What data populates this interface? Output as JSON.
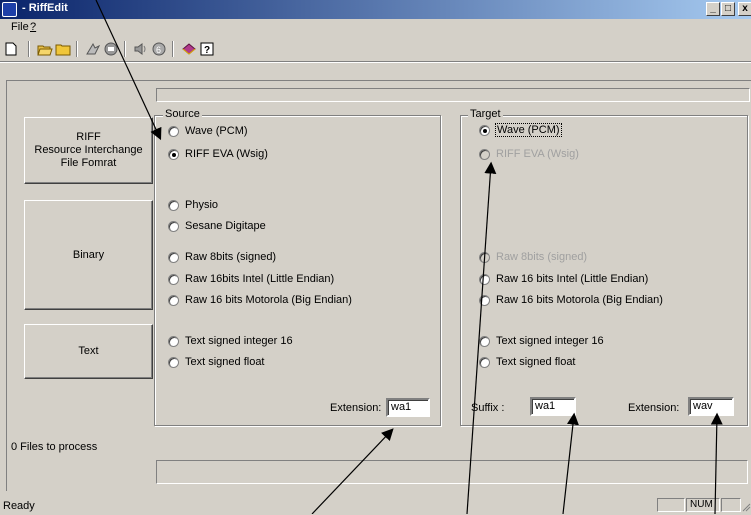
{
  "window": {
    "title": "- RiffEdit",
    "minimize": "_",
    "maximize": "□",
    "close": "x"
  },
  "menu": {
    "file": "File",
    "help": "?"
  },
  "toolbar": {
    "icons": [
      "new-icon",
      "open-icon",
      "folder-icon",
      "convert-icon",
      "stop-icon",
      "speaker-icon",
      "record-icon",
      "book-icon",
      "help-icon"
    ]
  },
  "sidebar": {
    "riff": "RIFF\nResource Interchange\nFile Fomrat",
    "binary": "Binary",
    "text": "Text"
  },
  "source": {
    "label": "Source",
    "options": {
      "wave": "Wave (PCM)",
      "riff_eva": "RIFF EVA (Wsig)",
      "physio": "Physio",
      "sesane": "Sesane Digitape",
      "raw8": "Raw 8bits (signed)",
      "raw16_intel": "Raw 16bits Intel (Little Endian)",
      "raw16_motorola": "Raw 16 bits Motorola (Big Endian)",
      "text_int16": "Text signed integer 16",
      "text_float": "Text signed float"
    },
    "selected": "riff_eva",
    "extension_label": "Extension:",
    "extension_value": "wa1"
  },
  "target": {
    "label": "Target",
    "options": {
      "wave": "Wave (PCM)",
      "riff_eva": "RIFF EVA (Wsig)",
      "raw8": "Raw 8bits (signed)",
      "raw16_intel": "Raw 16 bits Intel (Little Endian)",
      "raw16_motorola": "Raw 16 bits Motorola (Big Endian)",
      "text_int16": "Text signed integer 16",
      "text_float": "Text signed float"
    },
    "selected": "wave",
    "suffix_label": "Suffix :",
    "suffix_value": "wa1",
    "extension_label": "Extension:",
    "extension_value": "wav"
  },
  "files_to_process": "0 Files to process",
  "status": {
    "text": "Ready",
    "num": "NUM"
  },
  "colors": {
    "titlebar_start": "#0a246a",
    "titlebar_end": "#a6caf0",
    "face": "#d4d0c8"
  }
}
